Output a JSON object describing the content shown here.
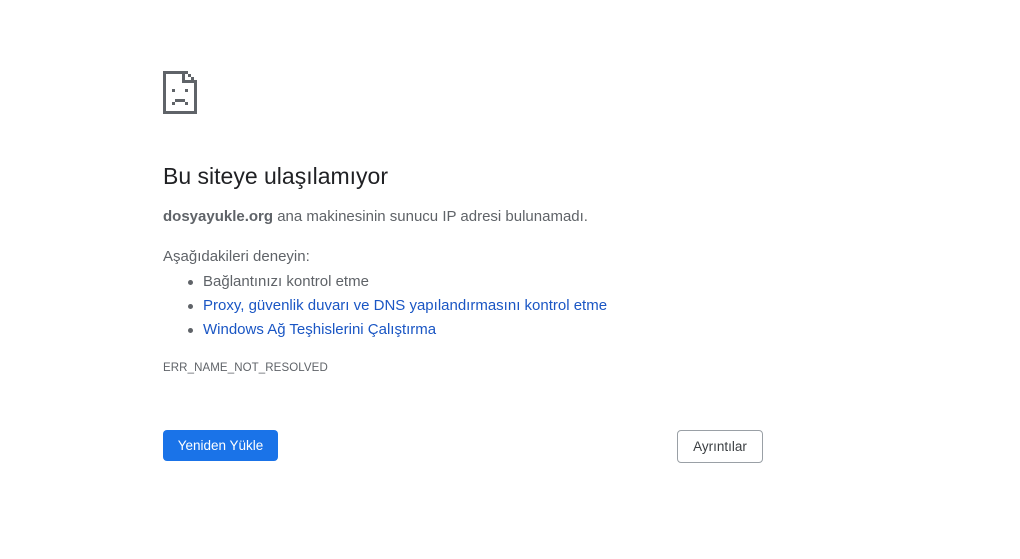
{
  "error_page": {
    "icon": "sad-page-icon",
    "title": "Bu siteye ulaşılamıyor",
    "description": {
      "host": "dosyayukle.org",
      "message": " ana makinesinin sunucu IP adresi bulunamadı."
    },
    "try_label": "Aşağıdakileri deneyin:",
    "suggestions": [
      {
        "label": "Bağlantınızı kontrol etme",
        "is_link": false
      },
      {
        "label": "Proxy, güvenlik duvarı ve DNS yapılandırmasını kontrol etme",
        "is_link": true
      },
      {
        "label": "Windows Ağ Teşhislerini Çalıştırma",
        "is_link": true
      }
    ],
    "error_code": "ERR_NAME_NOT_RESOLVED",
    "reload_label": "Yeniden Yükle",
    "details_label": "Ayrıntılar"
  },
  "colors": {
    "primary_blue": "#1a73e8",
    "link_blue": "#1a56c4",
    "text_gray": "#5f6368",
    "title_dark": "#202124"
  }
}
